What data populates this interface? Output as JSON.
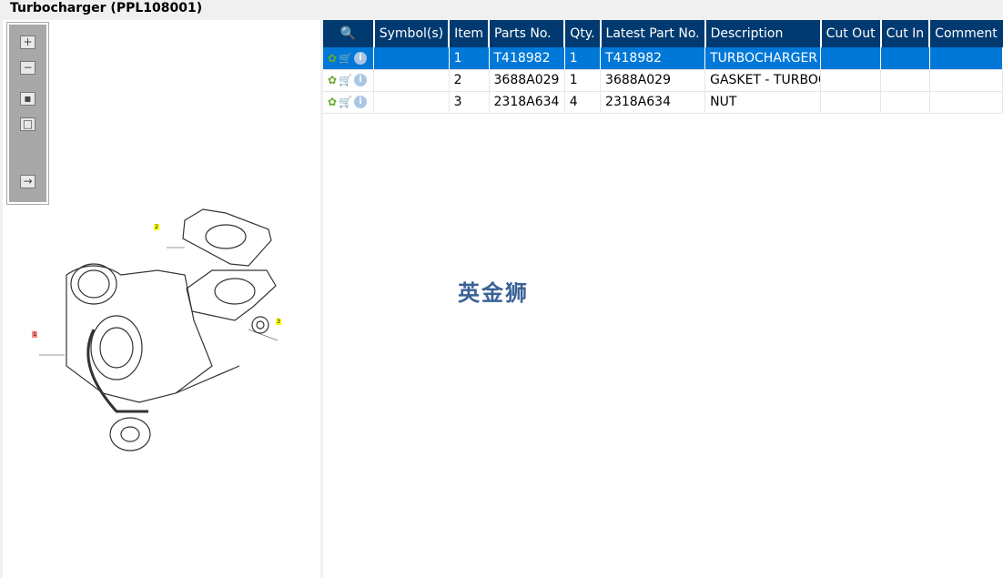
{
  "title": "Turbocharger (PPL108001)",
  "toolbar": {
    "items": [
      "zoom-in",
      "zoom-out",
      "fit-all",
      "fit-window",
      "export"
    ]
  },
  "diagram": {
    "callouts": [
      "1",
      "2",
      "3"
    ]
  },
  "table": {
    "headers": [
      "",
      "Symbol(s)",
      "Item",
      "Parts No.",
      "Qty.",
      "Latest Part No.",
      "Description",
      "Cut Out",
      "Cut In",
      "Comment"
    ],
    "rows": [
      {
        "symbols": "",
        "item": "1",
        "parts_no": "T418982",
        "qty": "1",
        "latest": "T418982",
        "description": "TURBOCHARGER",
        "cut_out": "",
        "cut_in": "",
        "comment": "",
        "selected": true
      },
      {
        "symbols": "",
        "item": "2",
        "parts_no": "3688A029",
        "qty": "1",
        "latest": "3688A029",
        "description": "GASKET - TURBOC",
        "cut_out": "",
        "cut_in": "",
        "comment": ""
      },
      {
        "symbols": "",
        "item": "3",
        "parts_no": "2318A634",
        "qty": "4",
        "latest": "2318A634",
        "description": "NUT",
        "cut_out": "",
        "cut_in": "",
        "comment": ""
      }
    ]
  },
  "watermark": "英金狮",
  "colors": {
    "header": "#003a70",
    "selected": "#0078d7"
  }
}
